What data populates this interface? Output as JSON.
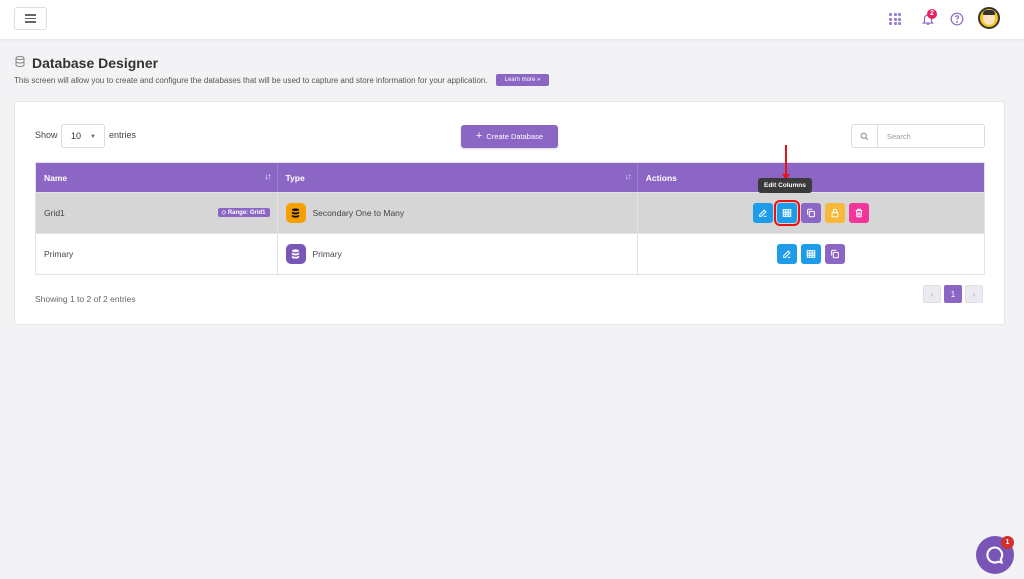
{
  "topbar": {
    "notifications_count": "2",
    "icons": [
      "menu-icon",
      "apps-grid-icon",
      "bell-icon",
      "help-icon",
      "user-avatar"
    ]
  },
  "header": {
    "title": "Database Designer",
    "subtitle": "This screen will allow you to create and configure the databases that will be used to capture and store information for your application.",
    "learn_more": "Learn more »"
  },
  "controls": {
    "show_label": "Show",
    "entries_value": "10",
    "entries_label": "entries",
    "create_button": "Create Database",
    "search_placeholder": "Search"
  },
  "table": {
    "columns": [
      "Name",
      "Type",
      "Actions"
    ],
    "rows": [
      {
        "name": "Grid1",
        "badge": "Range: Grid1",
        "type": "Secondary One to Many",
        "type_color": "#f5a000"
      },
      {
        "name": "Primary",
        "badge": "",
        "type": "Primary",
        "type_color": "#7a55b8"
      }
    ]
  },
  "tooltip": "Edit Columns",
  "footer": {
    "showing": "Showing 1 to 2 of 2 entries",
    "current_page": "1",
    "prev": "‹",
    "next": "›"
  },
  "chat": {
    "badge": "1"
  },
  "colors": {
    "accent": "#8b66c4",
    "blue": "#1e9be9",
    "yellow": "#f8b93a",
    "pink": "#f2359b",
    "highlight": "#ee1111"
  }
}
